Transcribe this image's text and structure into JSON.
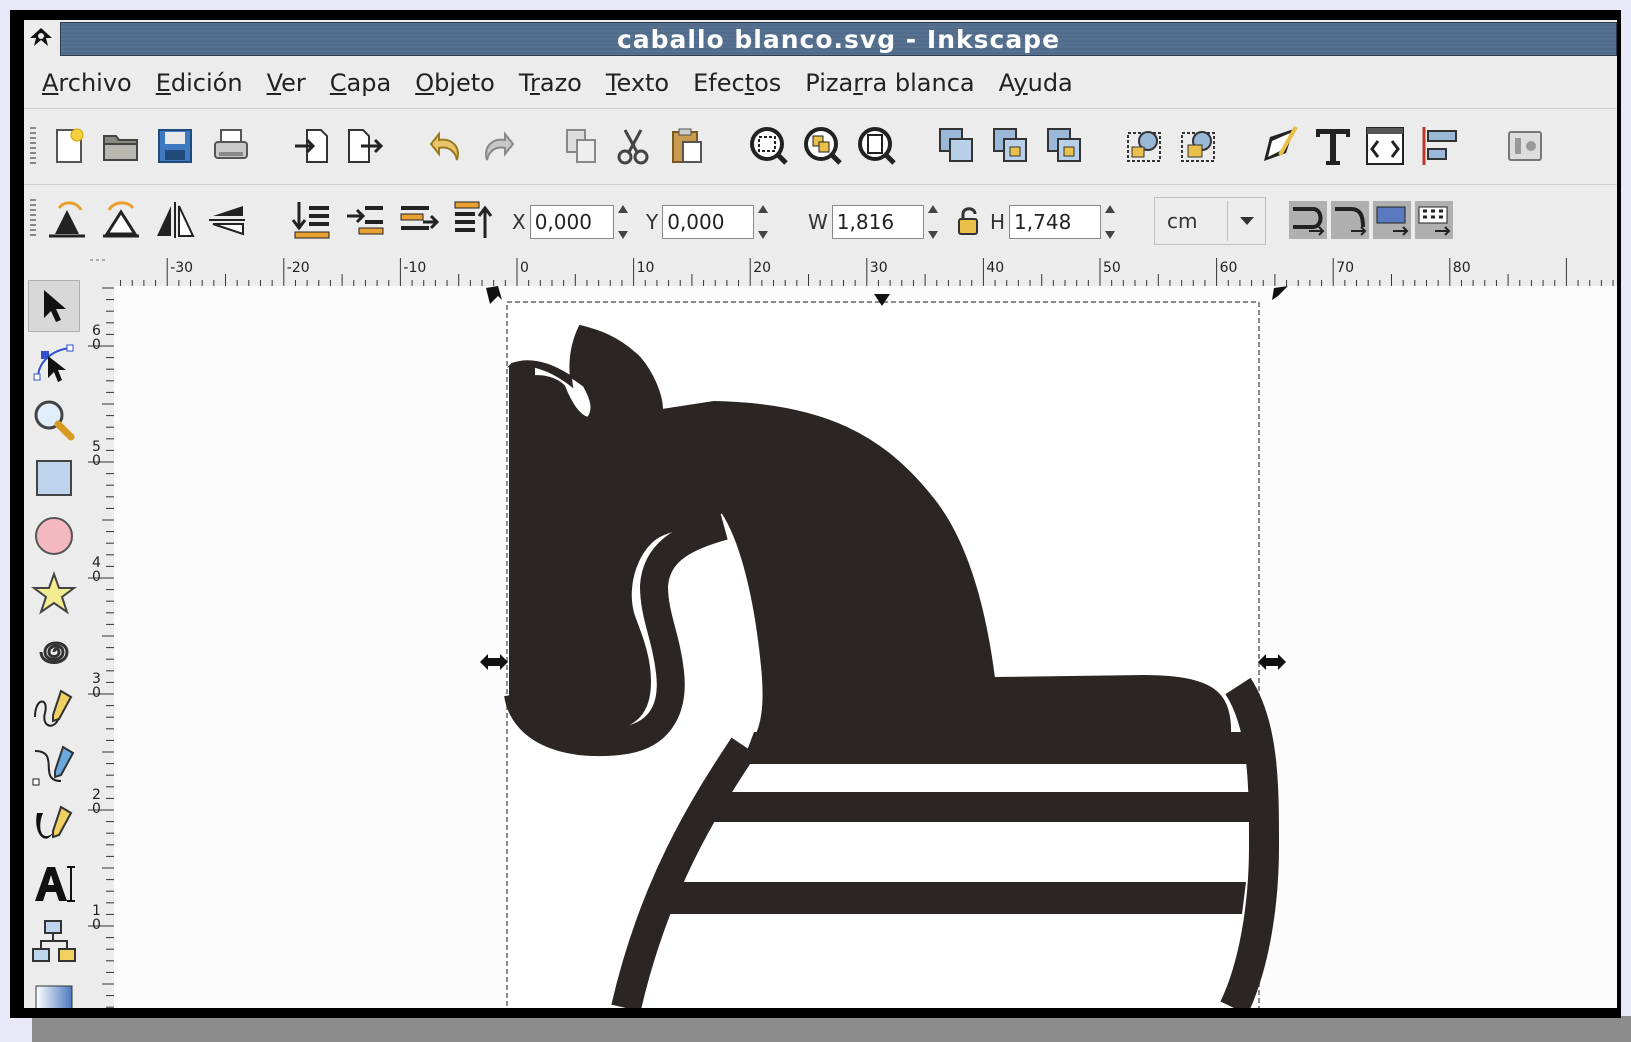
{
  "window": {
    "title": "caballo blanco.svg - Inkscape"
  },
  "menu": [
    {
      "label": "Archivo",
      "mnemonic_index": 0
    },
    {
      "label": "Edición",
      "mnemonic_index": 0
    },
    {
      "label": "Ver",
      "mnemonic_index": 0
    },
    {
      "label": "Capa",
      "mnemonic_index": 0
    },
    {
      "label": "Objeto",
      "mnemonic_index": 0
    },
    {
      "label": "Trazo",
      "mnemonic_index": 1
    },
    {
      "label": "Texto",
      "mnemonic_index": 0
    },
    {
      "label": "Efectos",
      "mnemonic_index": 4
    },
    {
      "label": "Pizarra blanca",
      "mnemonic_index": 4
    },
    {
      "label": "Ayuda",
      "mnemonic_index": 1
    }
  ],
  "commands_toolbar": {
    "icons": [
      "new-document-icon",
      "open-icon",
      "save-icon",
      "print-icon",
      "import-icon",
      "export-icon",
      "undo-icon",
      "redo-icon",
      "copy-icon",
      "cut-icon",
      "paste-icon",
      "zoom-selection-icon",
      "zoom-drawing-icon",
      "zoom-page-icon",
      "duplicate-icon",
      "clone-icon",
      "unlink-clone-icon",
      "group-icon",
      "ungroup-icon",
      "fill-stroke-icon",
      "text-font-icon",
      "xml-editor-icon",
      "align-distribute-icon",
      "preferences-icon"
    ]
  },
  "selector_toolbar": {
    "icons": [
      "rotate-ccw-icon",
      "rotate-cw-icon",
      "flip-horizontal-icon",
      "flip-vertical-icon",
      "raise-to-top-icon",
      "raise-icon",
      "lower-icon",
      "lower-to-bottom-icon"
    ],
    "x": {
      "label": "X",
      "value": "0,000"
    },
    "y": {
      "label": "Y",
      "value": "0,000"
    },
    "w": {
      "label": "W",
      "value": "1,816"
    },
    "h": {
      "label": "H",
      "value": "1,748"
    },
    "unit": "cm",
    "transform_icons": [
      "scale-stroke-icon",
      "scale-corners-icon",
      "move-gradients-icon",
      "move-patterns-icon"
    ]
  },
  "tools": [
    "selector-tool-icon",
    "node-tool-icon",
    "zoom-tool-icon",
    "rectangle-tool-icon",
    "ellipse-tool-icon",
    "star-tool-icon",
    "spiral-tool-icon",
    "pencil-tool-icon",
    "pen-tool-icon",
    "calligraphy-tool-icon",
    "text-tool-icon",
    "connector-tool-icon",
    "gradient-tool-icon"
  ],
  "hruler": {
    "labels": [
      "-30",
      "-20",
      "-10",
      "0",
      "10",
      "20",
      "30",
      "40",
      "50",
      "60",
      "70",
      "80"
    ]
  },
  "vruler": {
    "labels": [
      "60",
      "50",
      "40",
      "30",
      "20",
      "10"
    ]
  }
}
